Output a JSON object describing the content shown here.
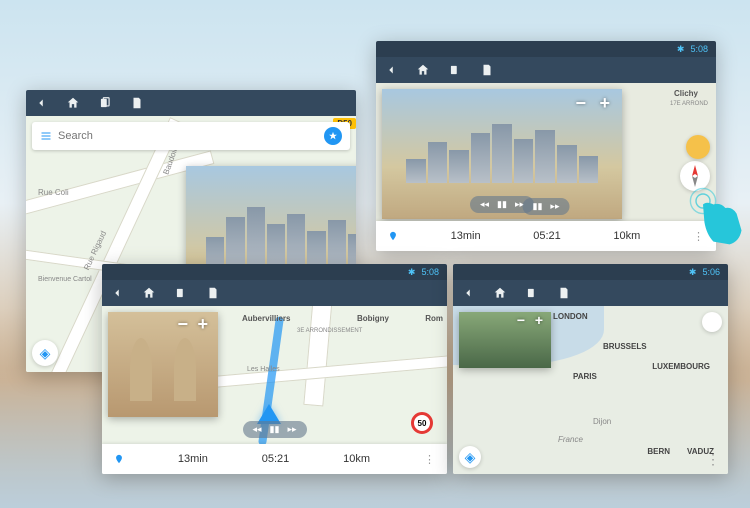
{
  "statusbar": {
    "time": "5:06",
    "time2": "5:08"
  },
  "search": {
    "placeholder": "Search"
  },
  "roadBadge": "D50",
  "panel1": {
    "streets": [
      "Rue Coli",
      "Rue Rigaud",
      "Baudoin"
    ],
    "welcome": "Bienvenue Cartol"
  },
  "panel2": {
    "duration": "13min",
    "eta": "05:21",
    "distance": "10km",
    "suburb": "Clichy",
    "arr": "17E ARROND"
  },
  "panel3": {
    "duration": "13min",
    "eta": "05:21",
    "distance": "10km",
    "places": [
      "Aubervilliers",
      "Bobigny",
      "Rom"
    ],
    "arr": "3E ARRONDISSEMENT",
    "hood": "Les Halles",
    "speed": "50"
  },
  "panel4": {
    "cities": [
      "LONDON",
      "BRUSSELS",
      "PARIS",
      "LUXEMBOURG",
      "BERN",
      "VADUZ"
    ],
    "places": [
      "Dijon",
      "France"
    ]
  }
}
